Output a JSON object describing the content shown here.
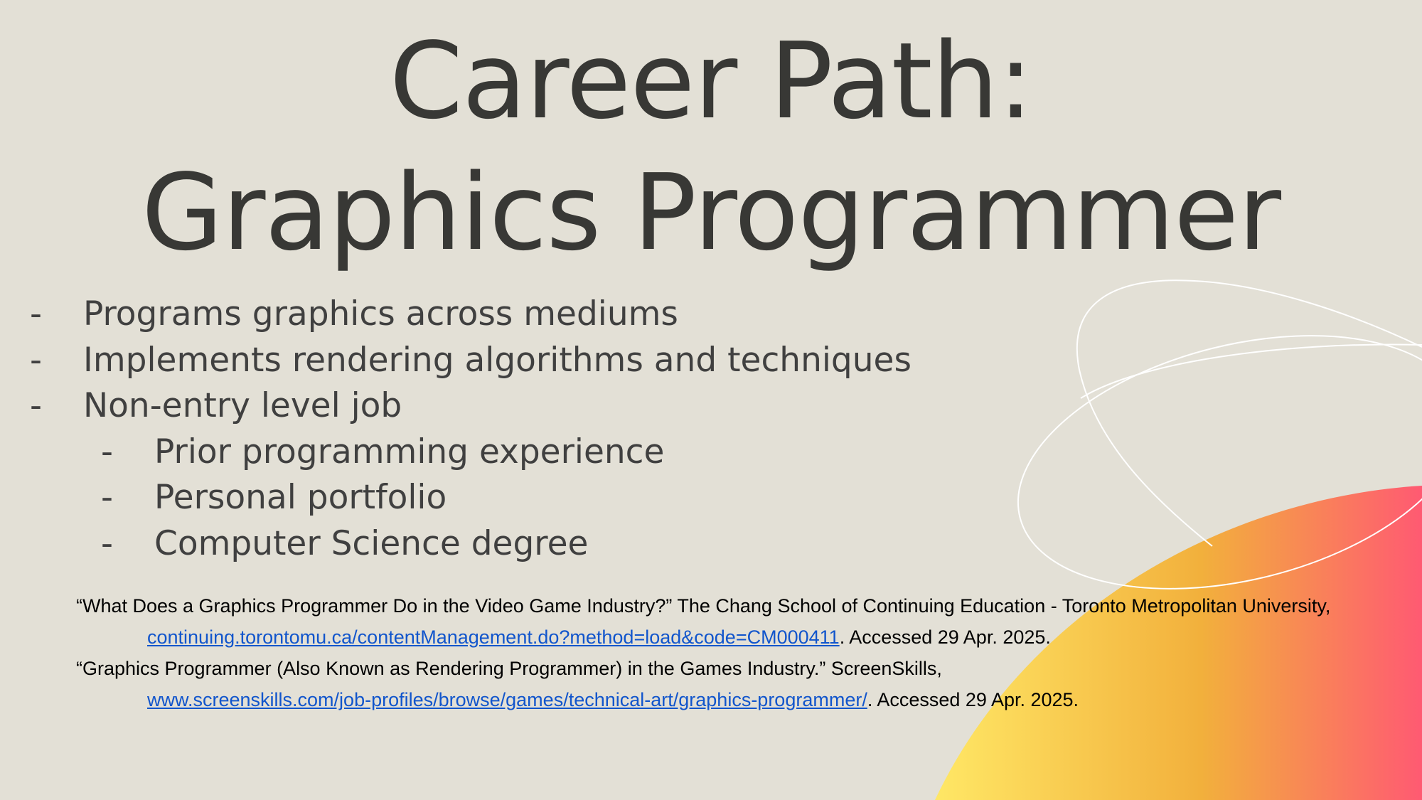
{
  "slide": {
    "title_line1": "Career Path:",
    "title_line2": "Graphics Programmer",
    "bullets": [
      {
        "dash": "-",
        "text": "Programs graphics across mediums"
      },
      {
        "dash": "-",
        "text": "Implements rendering algorithms and techniques"
      },
      {
        "dash": "-",
        "text": "Non-entry level job"
      }
    ],
    "sub_bullets": [
      {
        "dash": "-",
        "text": "Prior programming experience"
      },
      {
        "dash": "-",
        "text": "Personal portfolio"
      },
      {
        "dash": "-",
        "text": "Computer Science degree"
      }
    ],
    "references": [
      {
        "citation": "“What Does a Graphics Programmer Do in the Video Game Industry?” The Chang School of Continuing Education - Toronto Metropolitan University,",
        "link": "continuing.torontomu.ca/contentManagement.do?method=load&code=CM000411",
        "accessed": ". Accessed 29 Apr. 2025."
      },
      {
        "citation": "“Graphics Programmer (Also Known as Rendering Programmer) in the Games Industry.” ScreenSkills,",
        "link": "www.screenskills.com/job-profiles/browse/games/technical-art/graphics-programmer/",
        "accessed": ". Accessed 29 Apr. 2025."
      }
    ]
  },
  "colors": {
    "background": "#e3e0d6",
    "title": "#383835",
    "body_text": "#404040",
    "link": "#1155cc",
    "gradient_start": "#ffe866",
    "gradient_mid": "#f2b03c",
    "gradient_end": "#ff5a72",
    "outline_stroke": "#ffffff"
  }
}
